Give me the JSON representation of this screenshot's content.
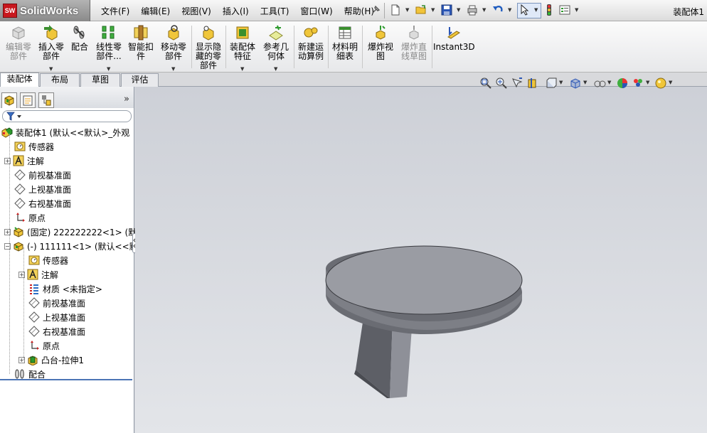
{
  "app": {
    "logo_badge": "SW",
    "logo_text": "SolidWorks",
    "doc_title": "装配体1"
  },
  "menus": [
    "文件(F)",
    "编辑(E)",
    "视图(V)",
    "插入(I)",
    "工具(T)",
    "窗口(W)",
    "帮助(H)"
  ],
  "commands": [
    {
      "label": "编辑零\n部件",
      "disabled": true,
      "icon": "edit-component-icon"
    },
    {
      "label": "插入零\n部件",
      "disabled": false,
      "icon": "insert-component-icon"
    },
    {
      "label": "配合",
      "disabled": false,
      "icon": "mate-icon"
    },
    {
      "label": "线性零\n部件...",
      "disabled": false,
      "icon": "linear-pattern-icon"
    },
    {
      "label": "智能扣\n件",
      "disabled": false,
      "icon": "smart-fastener-icon"
    },
    {
      "label": "移动零\n部件",
      "disabled": false,
      "icon": "move-component-icon"
    },
    {
      "label": "显示隐\n藏的零\n部件",
      "disabled": false,
      "icon": "show-hidden-icon"
    },
    {
      "label": "装配体\n特征",
      "disabled": false,
      "icon": "assembly-feature-icon"
    },
    {
      "label": "参考几\n何体",
      "disabled": false,
      "icon": "reference-geometry-icon"
    },
    {
      "label": "新建运\n动算例",
      "disabled": false,
      "icon": "motion-study-icon"
    },
    {
      "label": "材料明\n细表",
      "disabled": false,
      "icon": "bom-icon"
    },
    {
      "label": "爆炸视\n图",
      "disabled": false,
      "icon": "explode-view-icon"
    },
    {
      "label": "爆炸直\n线草图",
      "disabled": true,
      "icon": "explode-line-icon"
    },
    {
      "label": "Instant3D",
      "disabled": false,
      "icon": "instant3d-icon"
    }
  ],
  "tabs": [
    "装配体",
    "布局",
    "草图",
    "评估"
  ],
  "active_tab": "装配体",
  "tree": [
    {
      "text": "装配体1 (默认<<默认>_外观",
      "icon": "assembly-icon"
    },
    {
      "text": "传感器",
      "icon": "sensor-icon"
    },
    {
      "text": "注解",
      "icon": "annotation-icon"
    },
    {
      "text": "前视基准面",
      "icon": "plane-icon"
    },
    {
      "text": "上视基准面",
      "icon": "plane-icon"
    },
    {
      "text": "右视基准面",
      "icon": "plane-icon"
    },
    {
      "text": "原点",
      "icon": "origin-icon"
    },
    {
      "text": "(固定) 222222222<1> (默",
      "icon": "part-icon"
    },
    {
      "text": "(-) 111111<1> (默认<<默",
      "icon": "part-icon"
    },
    {
      "text": "传感器",
      "icon": "sensor-icon"
    },
    {
      "text": "注解",
      "icon": "annotation-icon"
    },
    {
      "text": "材质 <未指定>",
      "icon": "material-icon"
    },
    {
      "text": "前视基准面",
      "icon": "plane-icon"
    },
    {
      "text": "上视基准面",
      "icon": "plane-icon"
    },
    {
      "text": "右视基准面",
      "icon": "plane-icon"
    },
    {
      "text": "原点",
      "icon": "origin-icon"
    },
    {
      "text": "凸台-拉伸1",
      "icon": "extrude-icon"
    },
    {
      "text": "配合",
      "icon": "mates-folder-icon"
    }
  ]
}
